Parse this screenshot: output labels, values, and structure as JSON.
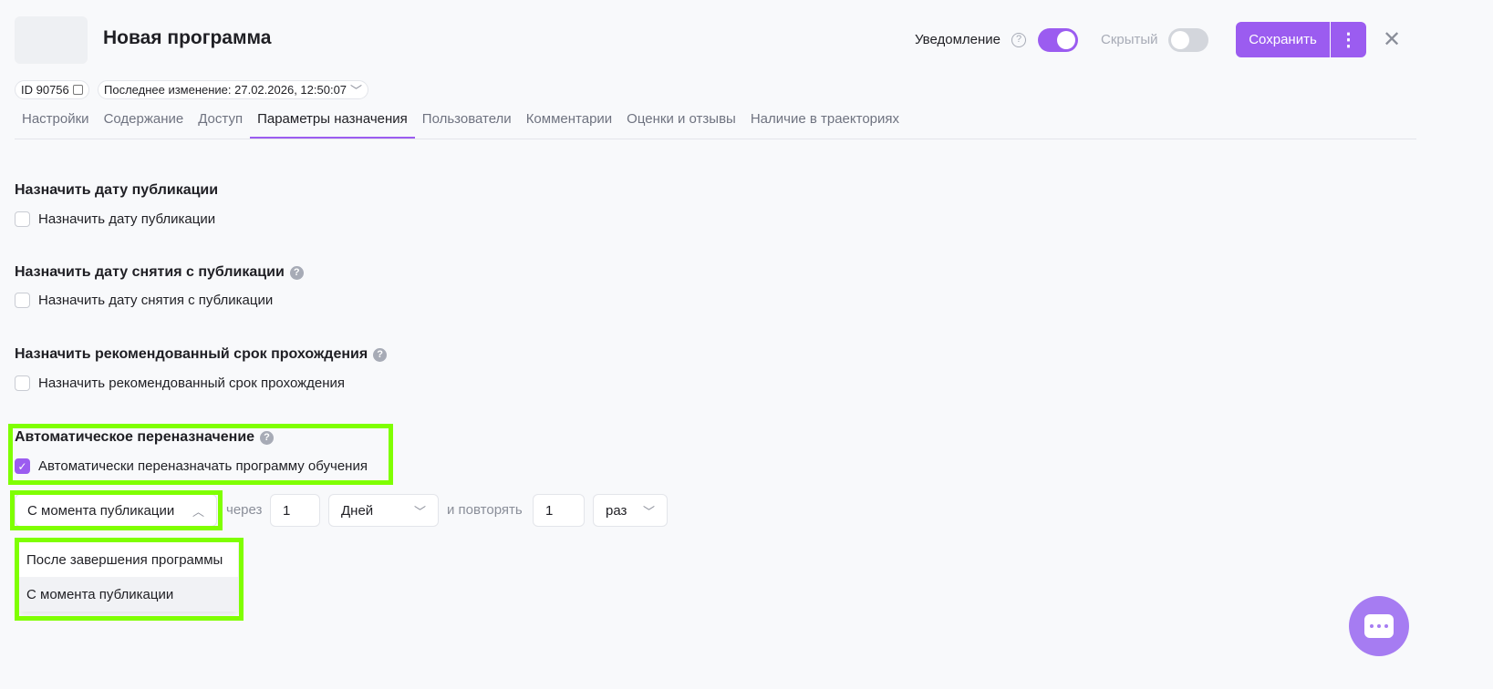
{
  "header": {
    "title": "Новая программа",
    "id_label": "ID 90756",
    "last_modified": "Последнее изменение: 27.02.2026, 12:50:07",
    "notification_label": "Уведомление",
    "notification_on": true,
    "hidden_label": "Скрытый",
    "hidden_on": false,
    "save_label": "Сохранить"
  },
  "tabs": [
    {
      "label": "Настройки"
    },
    {
      "label": "Содержание"
    },
    {
      "label": "Доступ"
    },
    {
      "label": "Параметры назначения",
      "active": true
    },
    {
      "label": "Пользователи"
    },
    {
      "label": "Комментарии"
    },
    {
      "label": "Оценки и отзывы"
    },
    {
      "label": "Наличие в траекториях"
    }
  ],
  "sections": [
    {
      "heading": "Назначить дату публикации",
      "checkbox": "Назначить дату публикации",
      "checked": false
    },
    {
      "heading": "Назначить дату снятия с публикации",
      "checkbox": "Назначить дату снятия с публикации",
      "checked": false
    },
    {
      "heading": "Назначить рекомендованный срок прохождения",
      "checkbox": "Назначить рекомендованный срок прохождения",
      "checked": false
    },
    {
      "heading": "Автоматическое переназначение",
      "checkbox": "Автоматически переназначать программу обучения",
      "checked": true
    }
  ],
  "reassign": {
    "start_select": "С момента публикации",
    "through_label": "через",
    "interval_value": "1",
    "unit_select": "Дней",
    "repeat_label": "и повторять",
    "repeat_value": "1",
    "repeat_unit": "раз",
    "options": [
      "После завершения программы",
      "С момента публикации"
    ]
  },
  "colors": {
    "accent": "#9b5cf0",
    "highlight": "#7fff00"
  }
}
